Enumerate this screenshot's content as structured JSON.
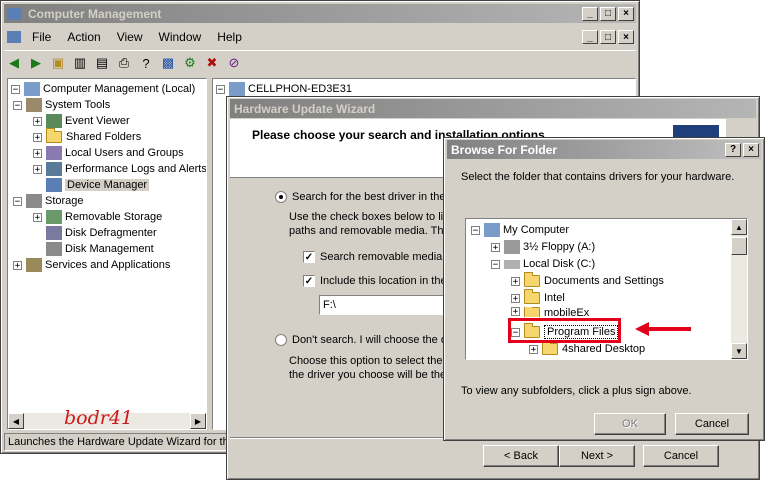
{
  "computer_management": {
    "title": "Computer Management",
    "menu": [
      "File",
      "Action",
      "View",
      "Window",
      "Help"
    ],
    "tree": [
      {
        "label": "Computer Management (Local)"
      },
      {
        "label": "System Tools"
      },
      {
        "label": "Event Viewer"
      },
      {
        "label": "Shared Folders"
      },
      {
        "label": "Local Users and Groups"
      },
      {
        "label": "Performance Logs and Alerts"
      },
      {
        "label": "Device Manager"
      },
      {
        "label": "Storage"
      },
      {
        "label": "Removable Storage"
      },
      {
        "label": "Disk Defragmenter"
      },
      {
        "label": "Disk Management"
      },
      {
        "label": "Services and Applications"
      }
    ],
    "right_root": "CELLPHON-ED3E31",
    "status": "Launches the Hardware Update Wizard for the",
    "watermark": "bodr41"
  },
  "wizard": {
    "title": "Hardware Update Wizard",
    "heading": "Please choose your search and installation options",
    "radio1": "Search for the best driver in thes",
    "desc1_line1": "Use the check boxes below to lir",
    "desc1_line2": "paths and removable media. The",
    "check1": "Search removable media (",
    "check2": "Include this location in the",
    "path_value": "F:\\",
    "radio2": "Don't search. I will choose the d",
    "desc2_line1": "Choose this option to select the d",
    "desc2_line2": "the driver you choose will be the",
    "back": "< Back",
    "next": "Next >",
    "cancel": "Cancel"
  },
  "browse": {
    "title": "Browse For Folder",
    "instruction": "Select the folder that contains drivers for your hardware.",
    "tree": [
      {
        "label": "My Computer"
      },
      {
        "label": "3½ Floppy (A:)"
      },
      {
        "label": "Local Disk (C:)"
      },
      {
        "label": "Documents and Settings"
      },
      {
        "label": "Intel"
      },
      {
        "label": "mobileEx"
      },
      {
        "label": "Program Files"
      },
      {
        "label": "4shared Desktop"
      }
    ],
    "hint": "To view any subfolders, click a plus sign above.",
    "ok": "OK",
    "cancel": "Cancel"
  },
  "colors": {
    "highlight": "#e3001b",
    "arrow": "#e3001b"
  }
}
